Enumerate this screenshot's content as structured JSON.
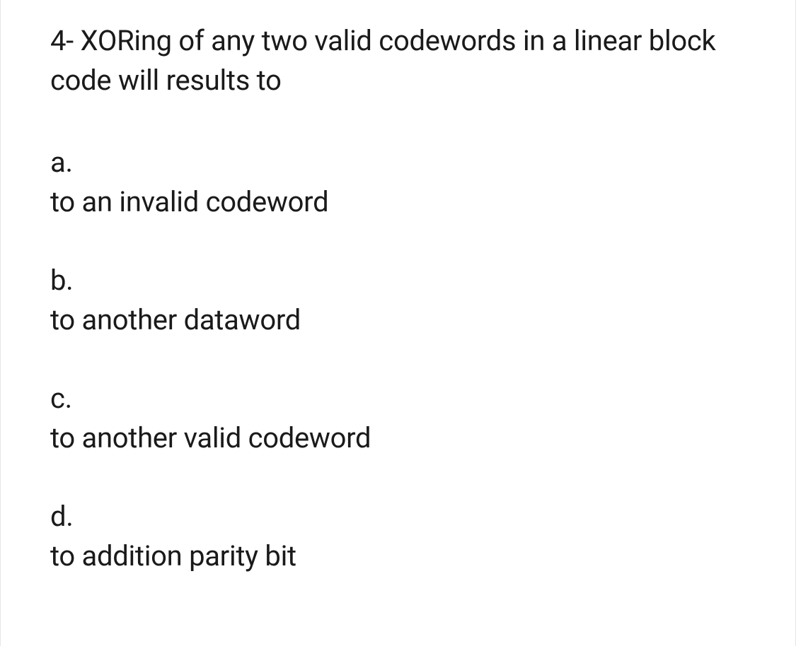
{
  "question": {
    "text": "4- XORing of any two valid codewords in a linear block code will results to",
    "options": [
      {
        "letter": "a.",
        "text": "to an invalid codeword"
      },
      {
        "letter": "b.",
        "text": "to another dataword"
      },
      {
        "letter": "c.",
        "text": "to another valid codeword"
      },
      {
        "letter": "d.",
        "text": "to addition parity bit"
      }
    ]
  }
}
